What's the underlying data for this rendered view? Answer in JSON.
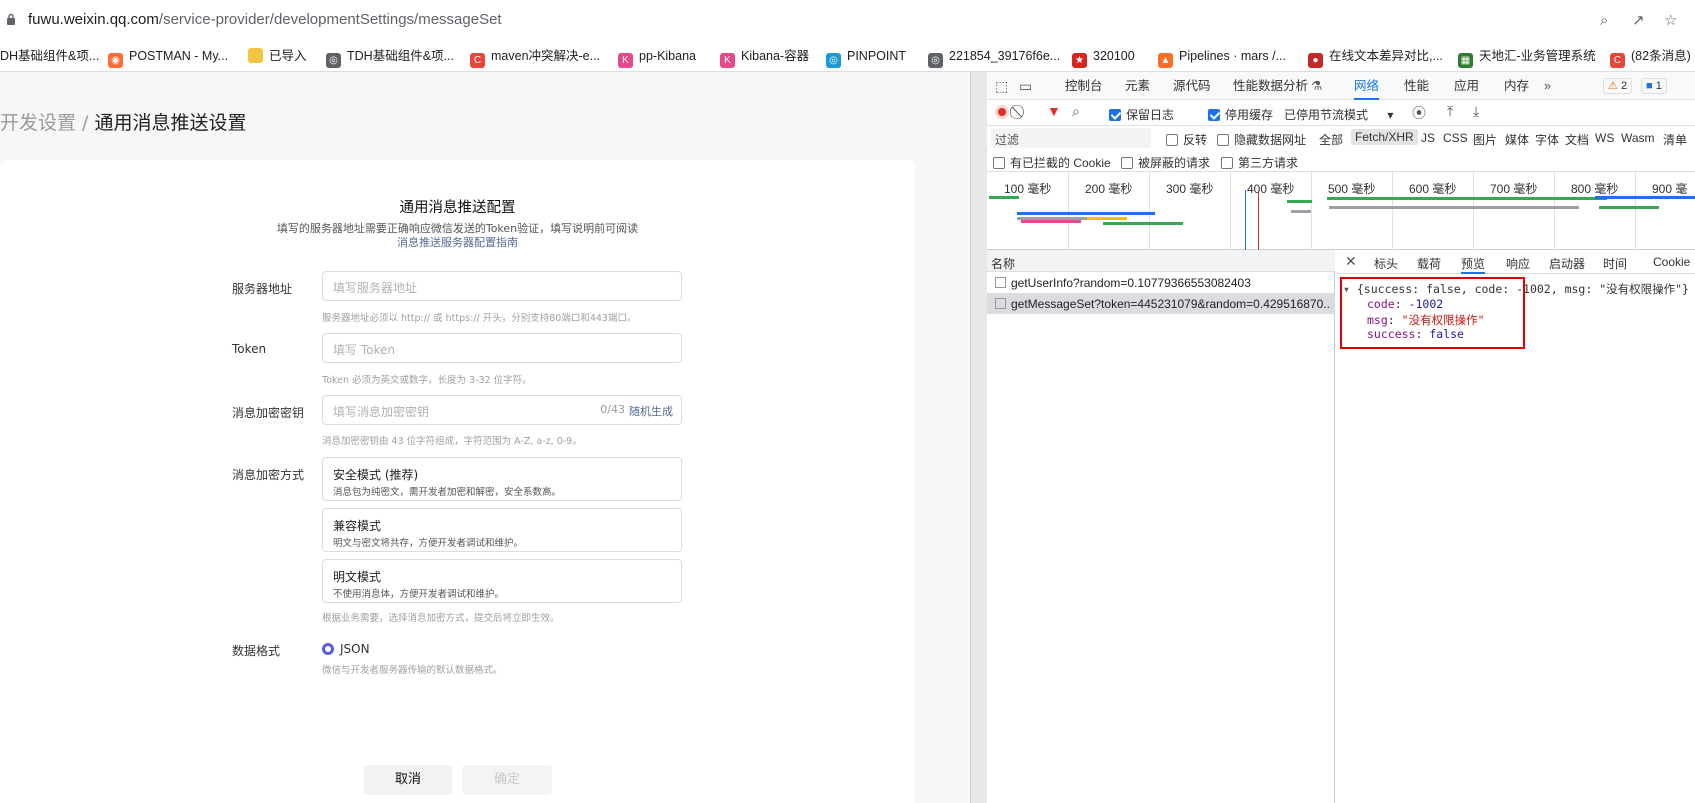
{
  "browser": {
    "url_host": "fuwu.weixin.qq.com",
    "url_path": "/service-provider/developmentSettings/messageSet",
    "bookmarks": [
      {
        "label": "DH基础组件&项...",
        "icon": "none"
      },
      {
        "label": "POSTMAN - My...",
        "icon": "postman-icon",
        "color": "#ff6c37"
      },
      {
        "label": "已导入",
        "icon": "folder-icon",
        "color": "#f4c542"
      },
      {
        "label": "TDH基础组件&项...",
        "icon": "globe-icon",
        "color": "#5f6368"
      },
      {
        "label": "maven冲突解决-e...",
        "icon": "c-icon",
        "color": "#e8453c"
      },
      {
        "label": "pp-Kibana",
        "icon": "kibana-icon",
        "color": "#e8478b"
      },
      {
        "label": "Kibana-容器",
        "icon": "kibana-icon",
        "color": "#e8478b"
      },
      {
        "label": "PINPOINT",
        "icon": "pinpoint-icon",
        "color": "#1a9bd7"
      },
      {
        "label": "221854_39176f6e...",
        "icon": "globe-icon",
        "color": "#5f6368"
      },
      {
        "label": "320100",
        "icon": "emblem-icon",
        "color": "#d7261e"
      },
      {
        "label": "Pipelines · mars /...",
        "icon": "gitlab-icon",
        "color": "#fc6d26"
      },
      {
        "label": "在线文本差异对比,...",
        "icon": "record-icon",
        "color": "#c62828"
      },
      {
        "label": "天地汇-业务管理系统",
        "icon": "grid-icon",
        "color": "#2e7d32"
      },
      {
        "label": "(82条消息)",
        "icon": "c-icon",
        "color": "#e8453c"
      }
    ]
  },
  "page": {
    "breadcrumb_parent": "开发设置",
    "breadcrumb_sep": " / ",
    "breadcrumb_current": "通用消息推送设置",
    "card_title": "通用消息推送配置",
    "card_desc": "填写的服务器地址需要正确响应微信发送的Token验证，填写说明前可阅读",
    "card_link": "消息推送服务器配置指南",
    "server_label": "服务器地址",
    "server_placeholder": "填写服务器地址",
    "server_hint": "服务器地址必须以 http:// 或 https:// 开头，分别支持80端口和443端口。",
    "token_label": "Token",
    "token_placeholder": "填写 Token",
    "token_hint": "Token 必须为英文或数字，长度为 3-32 位字符。",
    "key_label": "消息加密密钥",
    "key_placeholder": "填写消息加密密钥",
    "key_count": "0/43",
    "key_random": "随机生成",
    "key_hint": "消息加密密钥由 43 位字符组成，字符范围为 A-Z, a-z, 0-9。",
    "enc_label": "消息加密方式",
    "enc_options": [
      {
        "title": "安全模式 (推荐)",
        "desc": "消息包为纯密文，需开发者加密和解密，安全系数高。"
      },
      {
        "title": "兼容模式",
        "desc": "明文与密文将共存，方便开发者调试和维护。"
      },
      {
        "title": "明文模式",
        "desc": "不使用消息体，方便开发者调试和维护。"
      }
    ],
    "enc_hint": "根据业务需要，选择消息加密方式，提交后将立即生效。",
    "format_label": "数据格式",
    "format_value": "JSON",
    "format_hint": "微信与开发者服务器传输的默认数据格式。",
    "cancel": "取消",
    "confirm": "确定"
  },
  "devtools": {
    "tabs": [
      "控制台",
      "元素",
      "源代码",
      "性能数据分析",
      "网络",
      "性能",
      "应用",
      "内存"
    ],
    "active_tab": "网络",
    "warn_count": "2",
    "msg_count": "1",
    "preserve_log": "保留日志",
    "disable_cache": "停用缓存",
    "throttle": "已停用节流模式",
    "filter_placeholder": "过滤",
    "invert": "反转",
    "hide_data_urls": "隐藏数据网址",
    "type_filters": [
      "全部",
      "Fetch/XHR",
      "JS",
      "CSS",
      "图片",
      "媒体",
      "字体",
      "文档",
      "WS",
      "Wasm",
      "清单"
    ],
    "active_type": "Fetch/XHR",
    "blocked_cookies": "有已拦截的 Cookie",
    "blocked_requests": "被屏蔽的请求",
    "third_party": "第三方请求",
    "timeline_ticks": [
      "100 毫秒",
      "200 毫秒",
      "300 毫秒",
      "400 毫秒",
      "500 毫秒",
      "600 毫秒",
      "700 毫秒",
      "800 毫秒",
      "900 毫"
    ],
    "name_header": "名称",
    "requests": [
      "getUserInfo?random=0.10779366553082403",
      "getMessageSet?token=445231079&random=0.429516870..."
    ],
    "detail_tabs": [
      "标头",
      "载荷",
      "预览",
      "响应",
      "启动器",
      "时间",
      "Cookie"
    ],
    "active_detail": "预览",
    "preview_summary": "{success: false, code: -1002, msg: \"没有权限操作\"}",
    "preview_fields": [
      {
        "key": "code",
        "value": "-1002",
        "kind": "number"
      },
      {
        "key": "msg",
        "value": "\"没有权限操作\"",
        "kind": "string"
      },
      {
        "key": "success",
        "value": "false",
        "kind": "boolean"
      }
    ]
  }
}
